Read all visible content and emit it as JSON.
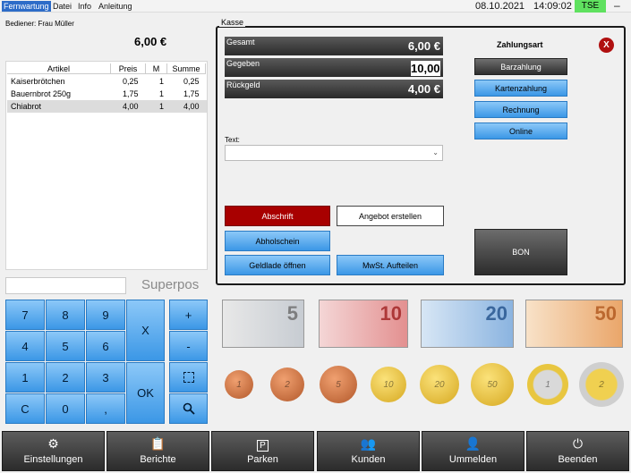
{
  "menubar": {
    "items": [
      "Fernwartung",
      "Datei",
      "Info",
      "Anleitung"
    ],
    "date": "08.10.2021",
    "time": "14:09:02",
    "tse": "TSE",
    "minimize": "–"
  },
  "left": {
    "waiter": "Bediener:  Frau Müller",
    "total": "6,00 €",
    "columns": [
      "Artikel",
      "Preis",
      "M",
      "Summe"
    ],
    "rows": [
      {
        "name": "Kaiserbrötchen",
        "price": "0,25",
        "qty": "1",
        "sum": "0,25"
      },
      {
        "name": "Bauernbrot 250g",
        "price": "1,75",
        "qty": "1",
        "sum": "1,75"
      },
      {
        "name": "Chiabrot",
        "price": "4,00",
        "qty": "1",
        "sum": "4,00"
      }
    ],
    "brand": "Superpos"
  },
  "keypad": {
    "keys": [
      "7",
      "8",
      "9",
      "X",
      "+",
      "4",
      "5",
      "6",
      "-",
      "1",
      "2",
      "3",
      "OK",
      "C",
      "0",
      ","
    ]
  },
  "kasse": {
    "legend": "Kasse",
    "total_label": "Gesamt",
    "total_value": "6,00 €",
    "given_label": "Gegeben",
    "given_value": "10,00",
    "change_label": "Rückgeld",
    "change_value": "4,00 €",
    "payment_title": "Zahlungsart",
    "close": "X",
    "payments": [
      "Barzahlung",
      "Kartenzahlung",
      "Rechnung",
      "Online"
    ],
    "text_label": "Text:",
    "buttons": {
      "abschrift": "Abschrift",
      "angebot": "Angebot erstellen",
      "abholschein": "Abholschein",
      "geldlade": "Geldlade öffnen",
      "mwst": "MwSt. Aufteilen",
      "bon": "BON"
    }
  },
  "money": {
    "notes": [
      "5",
      "10",
      "20",
      "50"
    ],
    "coins": [
      "1",
      "2",
      "5",
      "10",
      "20",
      "50",
      "1",
      "2"
    ]
  },
  "bottom": {
    "buttons": [
      "Einstellungen",
      "Berichte",
      "Parken",
      "Kunden",
      "Ummelden",
      "Beenden"
    ],
    "icons": [
      "gear-icon",
      "clipboard-icon",
      "parking-icon",
      "people-icon",
      "user-switch-icon",
      "power-icon"
    ]
  },
  "colors": {
    "accent": "#3b97e6",
    "dark": "#2b2b2b",
    "red": "#a80000",
    "tse": "#5fe15f"
  }
}
